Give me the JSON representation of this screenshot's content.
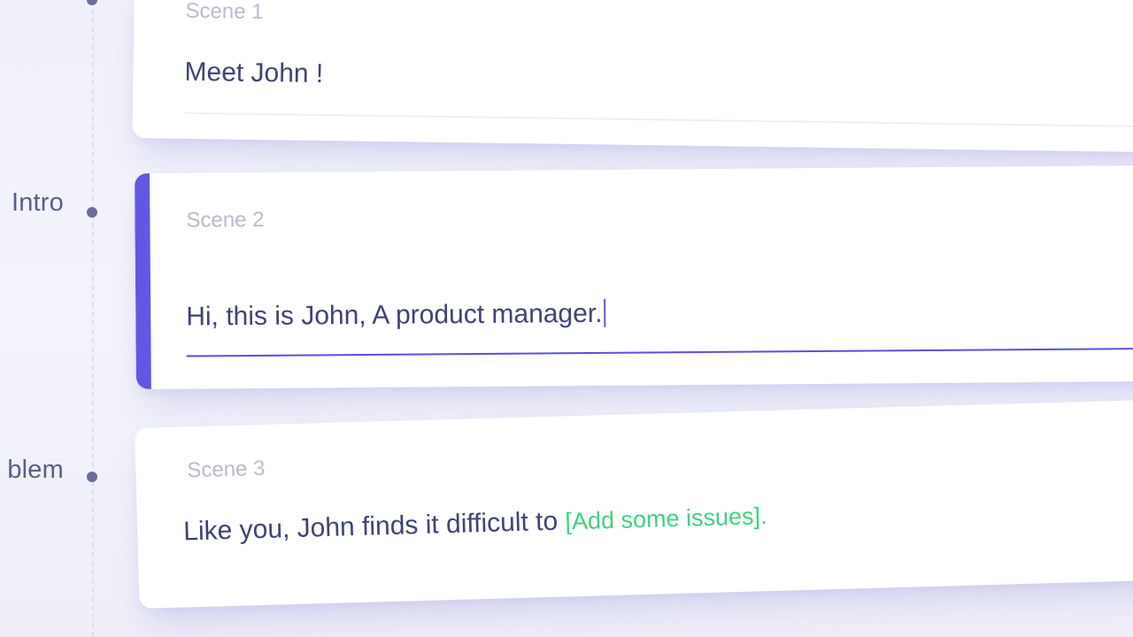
{
  "timeline": {
    "sections": [
      {
        "label": "Intro"
      },
      {
        "label": "blem"
      }
    ]
  },
  "scenes": [
    {
      "label": "Scene 1",
      "text": "Meet John !"
    },
    {
      "label": "Scene 2",
      "text": "Hi, this is John, A product manager.",
      "active": true
    },
    {
      "label": "Scene 3",
      "text": "Like you, John finds it difficult to",
      "placeholder": "[Add some issues]",
      "suffix": "."
    }
  ],
  "colors": {
    "accent": "#6257e2",
    "placeholder": "#3fd37c",
    "text": "#3f4475",
    "muted": "#b9bccf"
  }
}
